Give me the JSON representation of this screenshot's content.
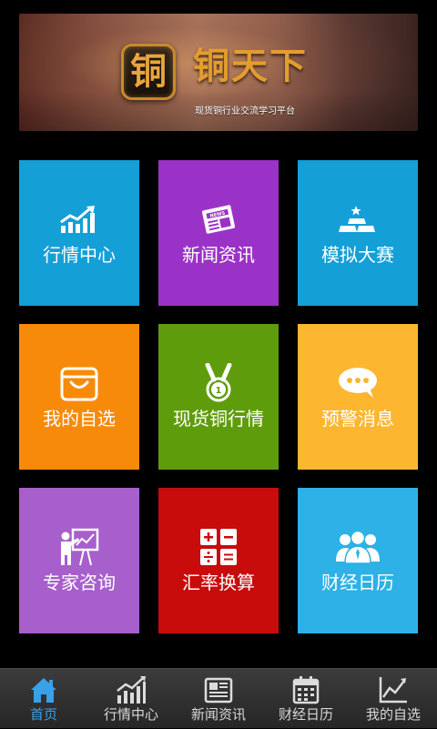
{
  "banner": {
    "badge_char": "铜",
    "title": "铜天下",
    "subtitle": "现货铜行业交流学习平台"
  },
  "tiles": [
    {
      "label": "行情中心",
      "icon": "chart-up-icon",
      "color": "#159fd7"
    },
    {
      "label": "新闻资讯",
      "icon": "newspaper-icon",
      "color": "#9b32c8"
    },
    {
      "label": "模拟大赛",
      "icon": "gold-bars-icon",
      "color": "#159fd7"
    },
    {
      "label": "我的自选",
      "icon": "basket-icon",
      "color": "#f88a0a"
    },
    {
      "label": "现货铜行情",
      "icon": "medal-icon",
      "color": "#5f9c0c"
    },
    {
      "label": "预警消息",
      "icon": "chat-bubble-icon",
      "color": "#fdb630"
    },
    {
      "label": "专家咨询",
      "icon": "presenter-icon",
      "color": "#a75fcc"
    },
    {
      "label": "汇率换算",
      "icon": "calculator-icon",
      "color": "#c80b0b"
    },
    {
      "label": "财经日历",
      "icon": "people-icon",
      "color": "#2db1e6"
    }
  ],
  "nav": {
    "items": [
      {
        "label": "首页",
        "icon": "home-icon",
        "active": true
      },
      {
        "label": "行情中心",
        "icon": "bar-chart-icon",
        "active": false
      },
      {
        "label": "新闻资讯",
        "icon": "newspaper-icon",
        "active": false
      },
      {
        "label": "财经日历",
        "icon": "calendar-icon",
        "active": false
      },
      {
        "label": "我的自选",
        "icon": "trend-line-icon",
        "active": false
      }
    ],
    "active_color": "#3aa0e8",
    "inactive_color": "#d8d8d8"
  }
}
